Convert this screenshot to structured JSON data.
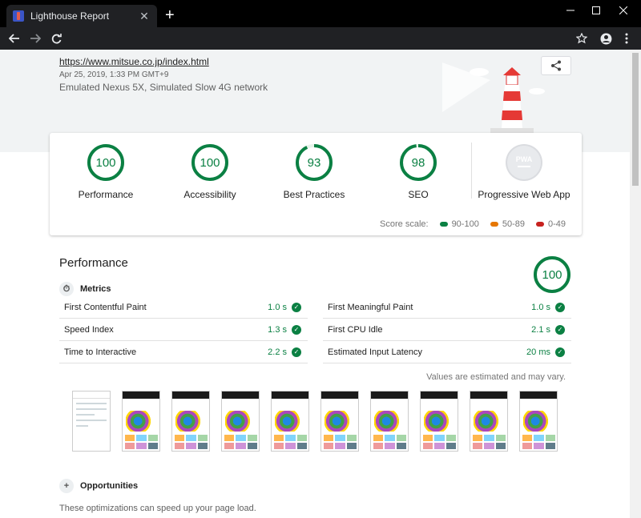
{
  "browser": {
    "tab_title": "Lighthouse Report",
    "new_tab": "+",
    "close_tab": "✕"
  },
  "report": {
    "url": "https://www.mitsue.co.jp/index.html",
    "date": "Apr 25, 2019, 1:33 PM GMT+9",
    "environment": "Emulated Nexus 5X, Simulated Slow 4G network"
  },
  "scores": [
    {
      "label": "Performance",
      "value": "100",
      "fraction": 1.0,
      "color": "#0b8043"
    },
    {
      "label": "Accessibility",
      "value": "100",
      "fraction": 1.0,
      "color": "#0b8043"
    },
    {
      "label": "Best Practices",
      "value": "93",
      "fraction": 0.93,
      "color": "#0b8043"
    },
    {
      "label": "SEO",
      "value": "98",
      "fraction": 0.98,
      "color": "#0b8043"
    }
  ],
  "pwa": {
    "label": "Progressive Web App",
    "badge": "PWA"
  },
  "scale": {
    "label": "Score scale:",
    "items": [
      {
        "range": "90-100",
        "color": "#0b8043"
      },
      {
        "range": "50-89",
        "color": "#e67700"
      },
      {
        "range": "0-49",
        "color": "#c7221f"
      }
    ]
  },
  "performance": {
    "title": "Performance",
    "score": "100",
    "metrics_heading": "Metrics",
    "metrics": [
      {
        "name": "First Contentful Paint",
        "value": "1.0 s"
      },
      {
        "name": "First Meaningful Paint",
        "value": "1.0 s"
      },
      {
        "name": "Speed Index",
        "value": "1.3 s"
      },
      {
        "name": "First CPU Idle",
        "value": "2.1 s"
      },
      {
        "name": "Time to Interactive",
        "value": "2.2 s"
      },
      {
        "name": "Estimated Input Latency",
        "value": "20 ms"
      }
    ],
    "estimate_note": "Values are estimated and may vary.",
    "opportunities_heading": "Opportunities",
    "opportunities_desc": "These optimizations can speed up your page load."
  }
}
